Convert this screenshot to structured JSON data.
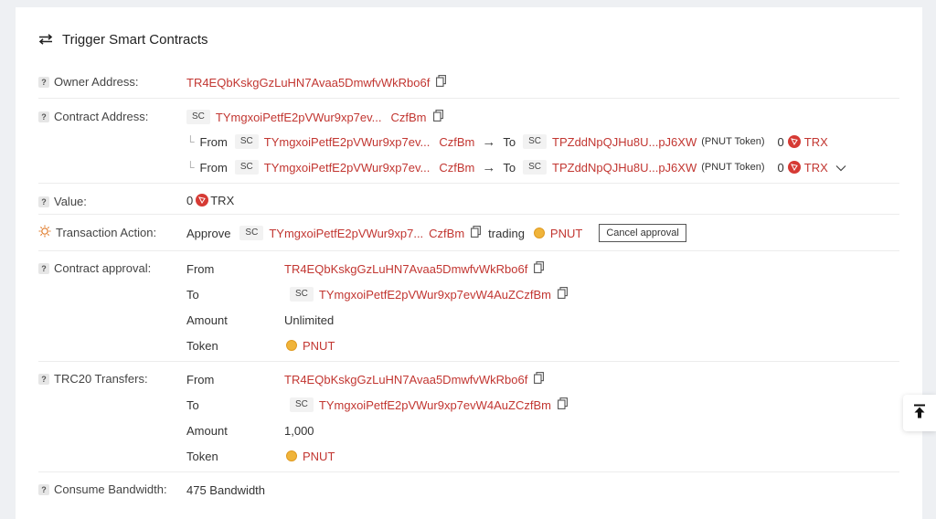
{
  "title": "Trigger Smart Contracts",
  "owner": {
    "label": "Owner Address:",
    "address": "TR4EQbKskgGzLuHN7Avaa5DmwfvWkRbo6f"
  },
  "contract": {
    "label": "Contract Address:",
    "sc": "SC",
    "addr_start": "TYmgxoiPetfE2pVWur9xp7ev...",
    "addr_end": "CzfBm",
    "transfers": [
      {
        "from_label": "From",
        "sc": "SC",
        "from_start": "TYmgxoiPetfE2pVWur9xp7ev...",
        "from_end": "CzfBm",
        "to_label": "To",
        "to_sc": "SC",
        "to_addr": "TPZddNpQJHu8U...pJ6XW",
        "token_note": "(PNUT Token)",
        "amount": "0",
        "currency": "TRX"
      },
      {
        "from_label": "From",
        "sc": "SC",
        "from_start": "TYmgxoiPetfE2pVWur9xp7ev...",
        "from_end": "CzfBm",
        "to_label": "To",
        "to_sc": "SC",
        "to_addr": "TPZddNpQJHu8U...pJ6XW",
        "token_note": "(PNUT Token)",
        "amount": "0",
        "currency": "TRX"
      }
    ]
  },
  "value": {
    "label": "Value:",
    "amount": "0",
    "currency": "TRX"
  },
  "action": {
    "label": "Transaction Action:",
    "verb": "Approve",
    "sc": "SC",
    "addr_start": "TYmgxoiPetfE2pVWur9xp7...",
    "addr_end": "CzfBm",
    "word": "trading",
    "token": "PNUT",
    "cancel": "Cancel approval"
  },
  "approval": {
    "label": "Contract approval:",
    "from_label": "From",
    "from": "TR4EQbKskgGzLuHN7Avaa5DmwfvWkRbo6f",
    "to_label": "To",
    "to_sc": "SC",
    "to": "TYmgxoiPetfE2pVWur9xp7evW4AuZCzfBm",
    "amount_label": "Amount",
    "amount": "Unlimited",
    "token_label": "Token",
    "token": "PNUT"
  },
  "trc20": {
    "label": "TRC20 Transfers:",
    "from_label": "From",
    "from": "TR4EQbKskgGzLuHN7Avaa5DmwfvWkRbo6f",
    "to_label": "To",
    "to_sc": "SC",
    "to": "TYmgxoiPetfE2pVWur9xp7evW4AuZCzfBm",
    "amount_label": "Amount",
    "amount": "1,000",
    "token_label": "Token",
    "token": "PNUT"
  },
  "bandwidth": {
    "label": "Consume Bandwidth:",
    "value": "475 Bandwidth"
  },
  "colors": {
    "link": "#c23631",
    "trx": "#d63a34",
    "pnut": "#f0b43a"
  }
}
